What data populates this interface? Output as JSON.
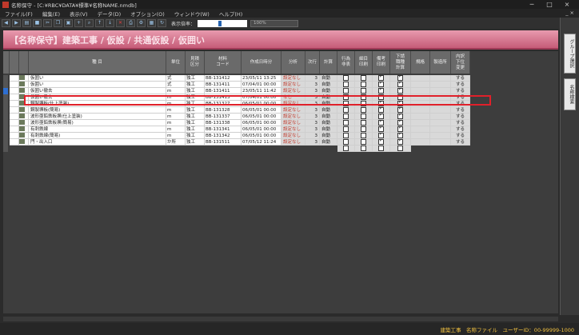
{
  "window": {
    "title": "名称保守 - [C:¥RBC¥DATA¥標準¥名称NAME.nmdb]",
    "minimize": "─",
    "maximize": "□",
    "close": "×"
  },
  "menu": {
    "items": [
      "ファイル(F)",
      "編集(E)",
      "表示(V)",
      "データ(D)",
      "オプション(O)",
      "ウィンドウ(W)",
      "ヘルプ(H)"
    ],
    "close": "_ ×"
  },
  "toolbar": {
    "zoom_label": "表示倍率：",
    "zoom_value": "100%"
  },
  "side_tabs": [
    "グループ選択",
    "名称検索"
  ],
  "banner": "【名称保守】建築工事 / 仮設 / 共通仮設 / 仮囲い",
  "columns": [
    "",
    "",
    "",
    "種 目",
    "単位",
    "見積\n区分",
    "材料\nコード",
    "作成日時分",
    "分析",
    "次行",
    "計算",
    "行為\n非表",
    "細目\n印刷",
    "備考\n印刷",
    "下請\n職種\n計算",
    "規格",
    "製造所",
    "内訳\n下位\n変更"
  ],
  "rows": [
    {
      "code": "",
      "name": "仮囲い",
      "unit": "式",
      "kubun": "独工",
      "mat": "BB-131412",
      "date": "23/05/11 13:25",
      "bunseki": "設定なし",
      "jigyo": "3",
      "calc": "自動",
      "c1": false,
      "c2": false,
      "c3": true,
      "c4": true,
      "naiyaku": "する"
    },
    {
      "code": "",
      "name": "仮囲い",
      "unit": "式",
      "kubun": "独工",
      "mat": "BB-131411",
      "date": "07/04/01 00:00",
      "bunseki": "設定なし",
      "jigyo": "3",
      "calc": "自動",
      "c1": false,
      "c2": false,
      "c3": true,
      "c4": true,
      "naiyaku": "する"
    },
    {
      "code": "",
      "name": "仮囲い撤去",
      "unit": "m",
      "kubun": "独工",
      "mat": "BB-131411",
      "date": "23/05/11 11:42",
      "bunseki": "設定なし",
      "jigyo": "3",
      "calc": "自動",
      "c1": false,
      "c2": false,
      "c3": true,
      "c4": true,
      "naiyaku": "する"
    },
    {
      "code": "",
      "name": "仮囲い撤去",
      "unit": "m",
      "kubun": "独工",
      "mat": "BB-131413",
      "date": "07/04/01 00:00",
      "bunseki": "なし",
      "jigyo": "3",
      "calc": "自動",
      "c1": false,
      "c2": false,
      "c3": true,
      "c4": true,
      "naiyaku": "する"
    },
    {
      "code": "",
      "name": "鋼製塀板(仕上塗装)",
      "unit": "m",
      "kubun": "独工",
      "mat": "BB-131327",
      "date": "06/05/01 00:00",
      "bunseki": "設定なし",
      "jigyo": "3",
      "calc": "自動",
      "c1": false,
      "c2": false,
      "c3": true,
      "c4": true,
      "naiyaku": "する"
    },
    {
      "code": "",
      "name": "鋼製塀板(簡易)",
      "unit": "m",
      "kubun": "独工",
      "mat": "BB-131328",
      "date": "06/05/01 00:00",
      "bunseki": "設定なし",
      "jigyo": "3",
      "calc": "自動",
      "c1": false,
      "c2": false,
      "c3": true,
      "c4": true,
      "naiyaku": "する"
    },
    {
      "code": "",
      "name": "波形亜鉛鉄板塀(仕上塗装)",
      "unit": "m",
      "kubun": "独工",
      "mat": "BB-131337",
      "date": "06/05/01 00:00",
      "bunseki": "設定なし",
      "jigyo": "3",
      "calc": "自動",
      "c1": false,
      "c2": false,
      "c3": true,
      "c4": true,
      "naiyaku": "する"
    },
    {
      "code": "",
      "name": "波形亜鉛鉄板塀(簡易)",
      "unit": "m",
      "kubun": "独工",
      "mat": "BB-131338",
      "date": "06/05/01 00:00",
      "bunseki": "設定なし",
      "jigyo": "3",
      "calc": "自動",
      "c1": false,
      "c2": false,
      "c3": true,
      "c4": true,
      "naiyaku": "する"
    },
    {
      "code": "",
      "name": "有刺鉄線",
      "unit": "m",
      "kubun": "独工",
      "mat": "BB-131341",
      "date": "06/05/01 00:00",
      "bunseki": "設定なし",
      "jigyo": "3",
      "calc": "自動",
      "c1": false,
      "c2": false,
      "c3": true,
      "c4": true,
      "naiyaku": "する"
    },
    {
      "code": "",
      "name": "有刺鉄線(簡易)",
      "unit": "m",
      "kubun": "独工",
      "mat": "BB-131342",
      "date": "06/05/01 00:00",
      "bunseki": "設定なし",
      "jigyo": "3",
      "calc": "自動",
      "c1": false,
      "c2": false,
      "c3": true,
      "c4": true,
      "naiyaku": "する"
    },
    {
      "code": "",
      "name": "門・出入口",
      "unit": "か所",
      "kubun": "独工",
      "mat": "BB-131511",
      "date": "07/05/12 11:24",
      "bunseki": "設定なし",
      "jigyo": "3",
      "calc": "自動",
      "c1": false,
      "c2": false,
      "c3": true,
      "c4": true,
      "naiyaku": "する"
    }
  ],
  "status": "建築工事　名称ファイル　ユーザーID：00-99999-1000"
}
